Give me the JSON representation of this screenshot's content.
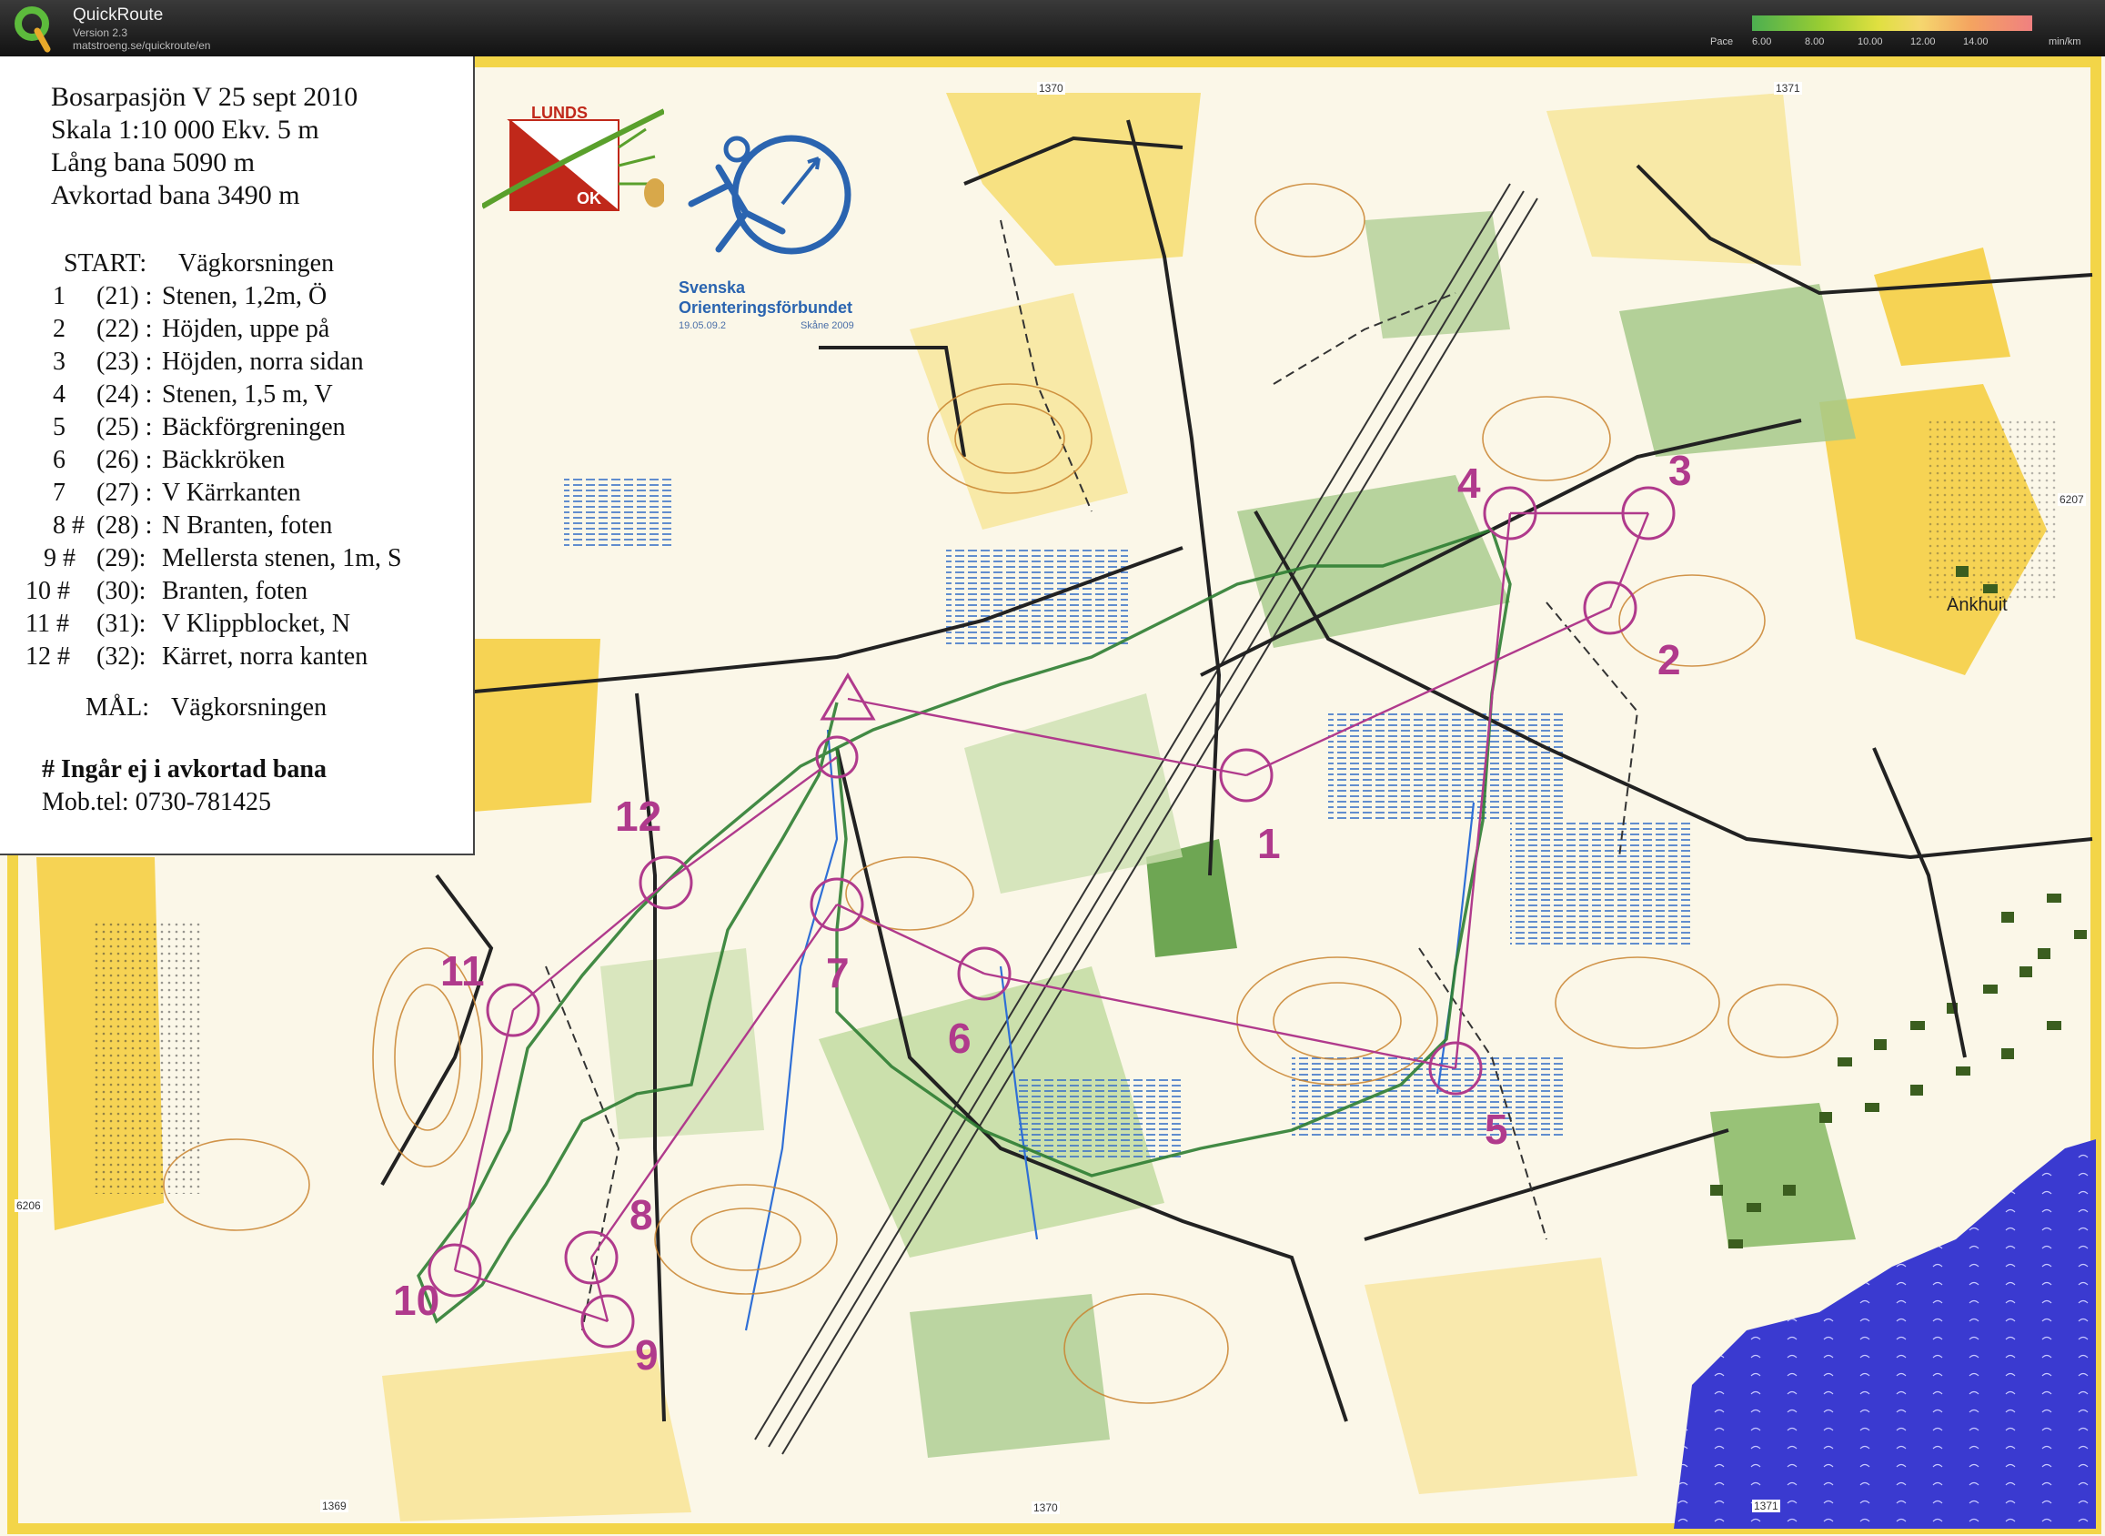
{
  "app": {
    "name": "QuickRoute",
    "version": "Version 2.3",
    "url": "matstroeng.se/quickroute/en"
  },
  "pace_legend": {
    "label": "Pace",
    "ticks": [
      "6.00",
      "8.00",
      "10.00",
      "12.00",
      "14.00"
    ],
    "unit": "min/km"
  },
  "course_info": {
    "title": "Bosarpasjön V 25 sept 2010",
    "scale_line": "Skala  1:10 000   Ekv.  5 m",
    "long_course": "Lång bana  5090 m",
    "short_course": "Avkortad bana 3490 m",
    "start_label": "START:",
    "start_desc": "Vägkorsningen",
    "controls": [
      {
        "num": "1",
        "code": "(21) :",
        "desc": "Stenen, 1,2m, Ö"
      },
      {
        "num": "2",
        "code": "(22) :",
        "desc": "Höjden, uppe på"
      },
      {
        "num": "3",
        "code": "(23) :",
        "desc": "Höjden, norra sidan"
      },
      {
        "num": "4",
        "code": "(24) :",
        "desc": "Stenen, 1,5 m, V"
      },
      {
        "num": "5",
        "code": "(25) :",
        "desc": "Bäckförgreningen"
      },
      {
        "num": "6",
        "code": "(26) :",
        "desc": "Bäckkröken"
      },
      {
        "num": "7",
        "code": "(27) :",
        "desc": "V Kärrkanten"
      },
      {
        "num": "8 #",
        "code": "(28) :",
        "desc": "N Branten, foten"
      },
      {
        "num": "9 #",
        "code": "(29):",
        "desc": "Mellersta stenen, 1m, S"
      },
      {
        "num": "10  #",
        "code": "(30):",
        "desc": "Branten, foten"
      },
      {
        "num": "11  #",
        "code": "(31):",
        "desc": "V Klippblocket, N"
      },
      {
        "num": "12  #",
        "code": "(32):",
        "desc": "Kärret, norra kanten"
      }
    ],
    "finish_label": "MÅL:",
    "finish_desc": "Vägkorsningen",
    "note": "# Ingår ej i avkortad bana",
    "phone": "Mob.tel: 0730-781425"
  },
  "logos": {
    "club_top": "LUNDS",
    "club_bottom": "OK",
    "federation_line1": "Svenska",
    "federation_line2": "Orienteringsförbundet",
    "federation_date": "19.05.09.2",
    "federation_event": "Skåne 2009"
  },
  "map_labels": {
    "place": "Ankhuit",
    "grid": [
      "1370",
      "1371",
      "6207",
      "6206",
      "1369",
      "1370",
      "1371"
    ]
  },
  "control_labels": [
    "1",
    "2",
    "3",
    "4",
    "5",
    "6",
    "7",
    "8",
    "9",
    "10",
    "11",
    "12"
  ],
  "colors": {
    "course_purple": "#b03a8c",
    "route_green": "#2e7d32",
    "map_yellow": "#f7d24a",
    "map_green": "#a6c98a",
    "lake_blue": "#3a3ad0"
  }
}
